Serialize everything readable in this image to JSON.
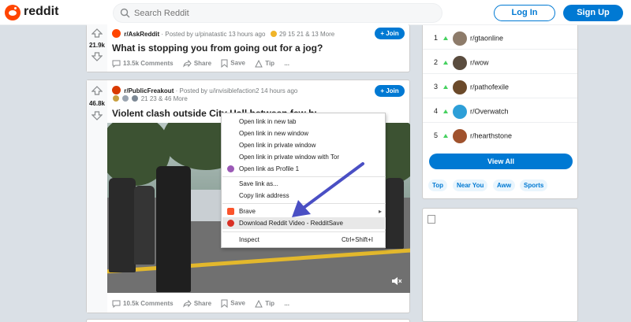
{
  "header": {
    "brand": "reddit",
    "search_placeholder": "Search Reddit",
    "login_label": "Log In",
    "signup_label": "Sign Up"
  },
  "posts": [
    {
      "votes": "21.9k",
      "subreddit": "r/AskReddit",
      "posted_by": "· Posted by u/pinatastic 13 hours ago",
      "awards_text": "29  15  21 & 13 More",
      "join_label": "Join",
      "title": "What is stopping you from going out for a jog?",
      "comments": "13.5k Comments",
      "share": "Share",
      "save": "Save",
      "tip": "Tip",
      "more": "..."
    },
    {
      "votes": "46.8k",
      "subreddit": "r/PublicFreakout",
      "posted_by": "· Posted by u/invisiblefaction2 14 hours ago",
      "awards_text": "21  23 & 46 More",
      "join_label": "Join",
      "title": "Violent clash outside City Hall between few hundred ...",
      "comments": "10.5k Comments",
      "share": "Share",
      "save": "Save",
      "tip": "Tip",
      "more": "..."
    }
  ],
  "context_menu": {
    "items": [
      {
        "label": "Open link in new tab"
      },
      {
        "label": "Open link in new window"
      },
      {
        "label": "Open link in private window"
      },
      {
        "label": "Open link in private window with Tor"
      },
      {
        "label": "Open link as Profile 1"
      },
      {
        "label": "Save link as..."
      },
      {
        "label": "Copy link address"
      },
      {
        "label": "Brave"
      },
      {
        "label": "Download Reddit Video - RedditSave"
      },
      {
        "label": "Inspect",
        "shortcut": "Ctrl+Shift+I"
      }
    ]
  },
  "sidebar": {
    "communities": [
      {
        "rank": "1",
        "name": "r/gtaonline"
      },
      {
        "rank": "2",
        "name": "r/wow"
      },
      {
        "rank": "3",
        "name": "r/pathofexile"
      },
      {
        "rank": "4",
        "name": "r/Overwatch"
      },
      {
        "rank": "5",
        "name": "r/hearthstone"
      }
    ],
    "view_all_label": "View All",
    "chips": [
      "Top",
      "Near You",
      "Aww",
      "Sports"
    ]
  },
  "colors": {
    "accent": "#0079d3",
    "reddit_orange": "#ff4500",
    "arrow_annotation": "#4a4fc4",
    "trend_green": "#46d160"
  }
}
